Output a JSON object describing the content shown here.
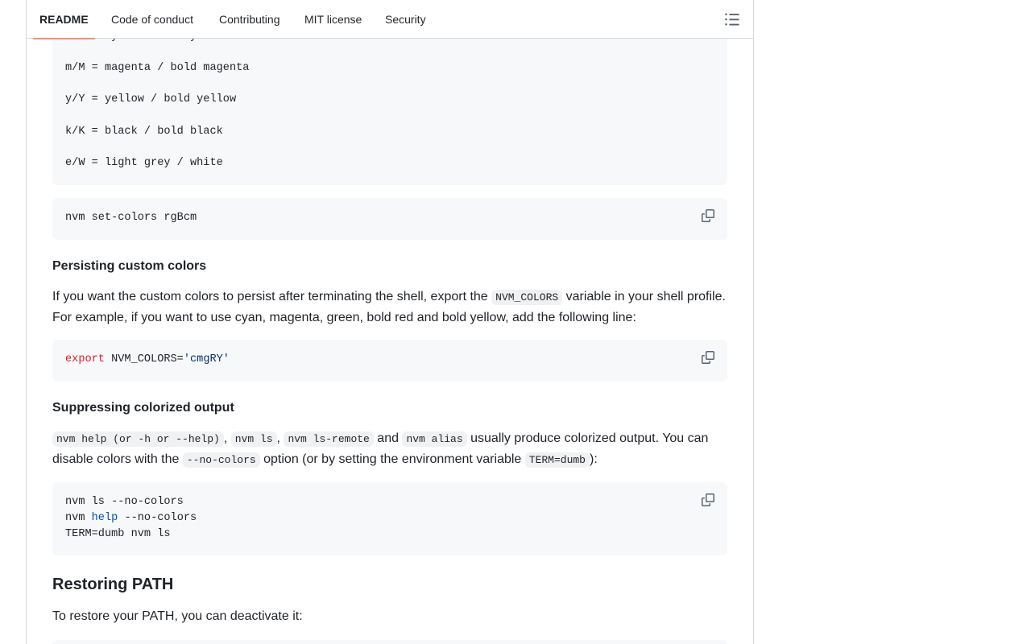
{
  "tabs": {
    "readme": "README",
    "conduct": "Code of conduct",
    "contributing": "Contributing",
    "license": "MIT license",
    "security": "Security"
  },
  "colors_block": {
    "line_cyan": "c/C = cyan / bold cyan",
    "line_magenta": "m/M = magenta / bold magenta",
    "line_yellow": "y/Y = yellow / bold yellow",
    "line_black": "k/K = black / bold black",
    "line_grey": "e/W = light grey / white"
  },
  "set_colors_cmd": "nvm set-colors rgBcm",
  "persist": {
    "heading": "Persisting custom colors",
    "p1": "If you want the custom colors to persist after terminating the shell, export the ",
    "code1": "NVM_COLORS",
    "p2": " variable in your shell profile. For example, if you want to use cyan, magenta, green, bold red and bold yellow, add the following line:",
    "export_kw": "export",
    "export_var": " NVM_COLORS=",
    "export_val": "'cmgRY'"
  },
  "suppress": {
    "heading": "Suppressing colorized output",
    "code1": "nvm help (or -h or --help)",
    "sep1": ", ",
    "code2": "nvm ls",
    "sep2": ", ",
    "code3": "nvm ls-remote",
    "and": " and ",
    "code4": "nvm alias",
    "t1": " usually produce colorized output. You can disable colors with the ",
    "code5": "--no-colors",
    "t2": " option (or by setting the environment variable ",
    "code6": "TERM=dumb",
    "t3": "):",
    "line1": "nvm ls --no-colors",
    "line2_pre": "nvm ",
    "line2_help": "help",
    "line2_post": " --no-colors",
    "line3": "TERM=dumb nvm ls"
  },
  "restore": {
    "heading": "Restoring PATH",
    "text": "To restore your PATH, you can deactivate it:"
  },
  "colors": {
    "accent_underline": "#fd8c73",
    "code_bg": "#f6f8fa",
    "keyword": "#cf222e",
    "string": "#0a3069",
    "function": "#0550ae"
  },
  "icons": [
    "list-unordered-icon",
    "copy-icon"
  ]
}
